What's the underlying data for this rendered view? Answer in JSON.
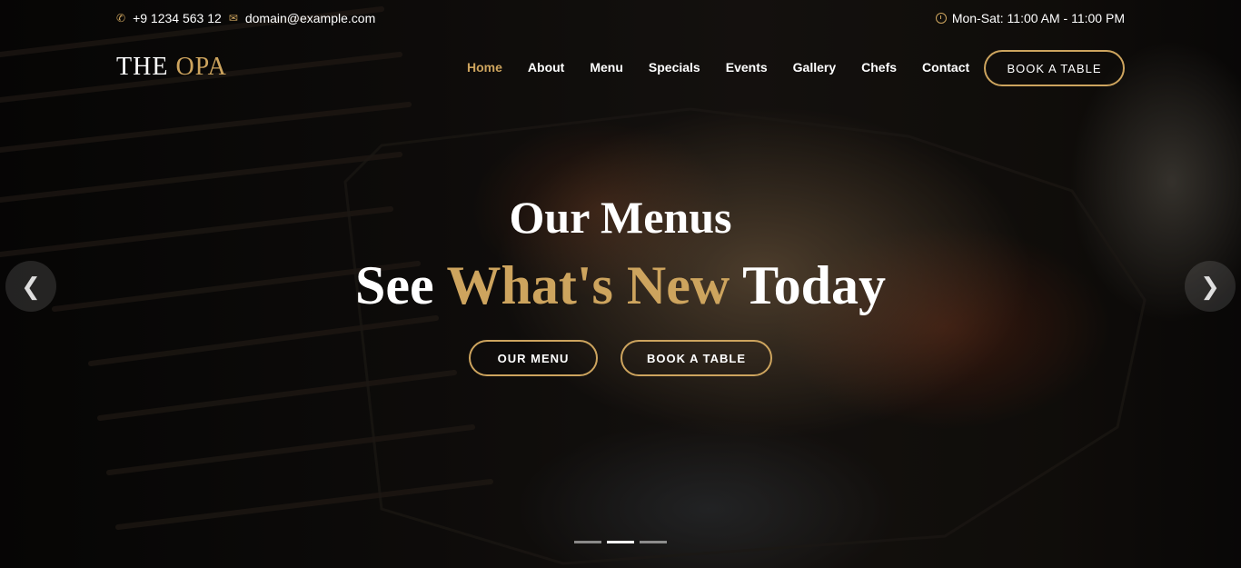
{
  "topbar": {
    "phone": "+9 1234 563 12",
    "email": "domain@example.com",
    "hours": "Mon-Sat: 11:00 AM - 11:00 PM"
  },
  "header": {
    "logo_main": "THE",
    "logo_accent": "OPA",
    "nav": [
      {
        "label": "Home",
        "active": true
      },
      {
        "label": "About"
      },
      {
        "label": "Menu"
      },
      {
        "label": "Specials"
      },
      {
        "label": "Events"
      },
      {
        "label": "Gallery"
      },
      {
        "label": "Chefs"
      },
      {
        "label": "Contact"
      }
    ],
    "book_button": "BOOK A TABLE"
  },
  "hero": {
    "title": "Our Menus",
    "subtitle_pre": "See",
    "subtitle_accent": "What's New",
    "subtitle_post": "Today",
    "btn_menu": "OUR MENU",
    "btn_book": "BOOK A TABLE",
    "slides_total": 3,
    "active_slide": 2
  },
  "icons": {
    "phone": "phone-icon",
    "email": "envelope-icon",
    "clock": "clock-icon",
    "prev": "chevron-left-icon",
    "next": "chevron-right-icon"
  },
  "colors": {
    "accent": "#cda45e",
    "background": "#0c0b0b"
  }
}
